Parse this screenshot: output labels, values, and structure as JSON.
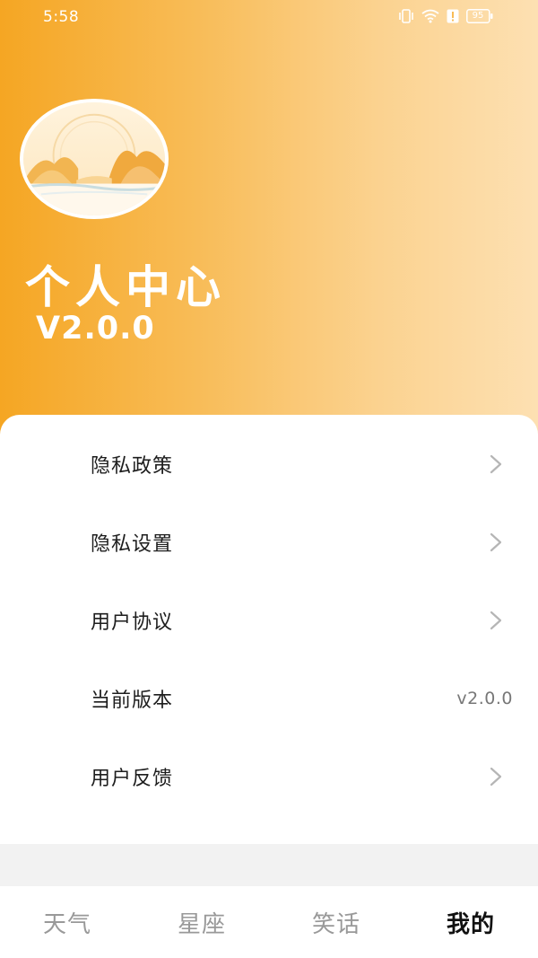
{
  "status_bar": {
    "time": "5:58",
    "battery": "95",
    "icons": [
      "vibrate-icon",
      "wifi-icon",
      "alert-icon",
      "battery-icon"
    ]
  },
  "profile": {
    "title": "个人中心",
    "version": "V2.0.0"
  },
  "menu": {
    "items": [
      {
        "label": "隐私政策",
        "icon": "chevron-right-icon"
      },
      {
        "label": "隐私设置",
        "icon": "chevron-right-icon"
      },
      {
        "label": "用户协议",
        "icon": "chevron-right-icon"
      },
      {
        "label": "当前版本",
        "value": "v2.0.0"
      },
      {
        "label": "用户反馈",
        "icon": "chevron-right-icon"
      }
    ]
  },
  "tabbar": {
    "tabs": [
      {
        "label": "天气",
        "active": false
      },
      {
        "label": "星座",
        "active": false
      },
      {
        "label": "笑话",
        "active": false
      },
      {
        "label": "我的",
        "active": true
      }
    ]
  },
  "colors": {
    "hero_start": "#f5a623",
    "hero_end": "#fde0b2",
    "text_primary": "#1d1d1d",
    "tab_inactive": "#999999",
    "tab_active": "#111111"
  }
}
